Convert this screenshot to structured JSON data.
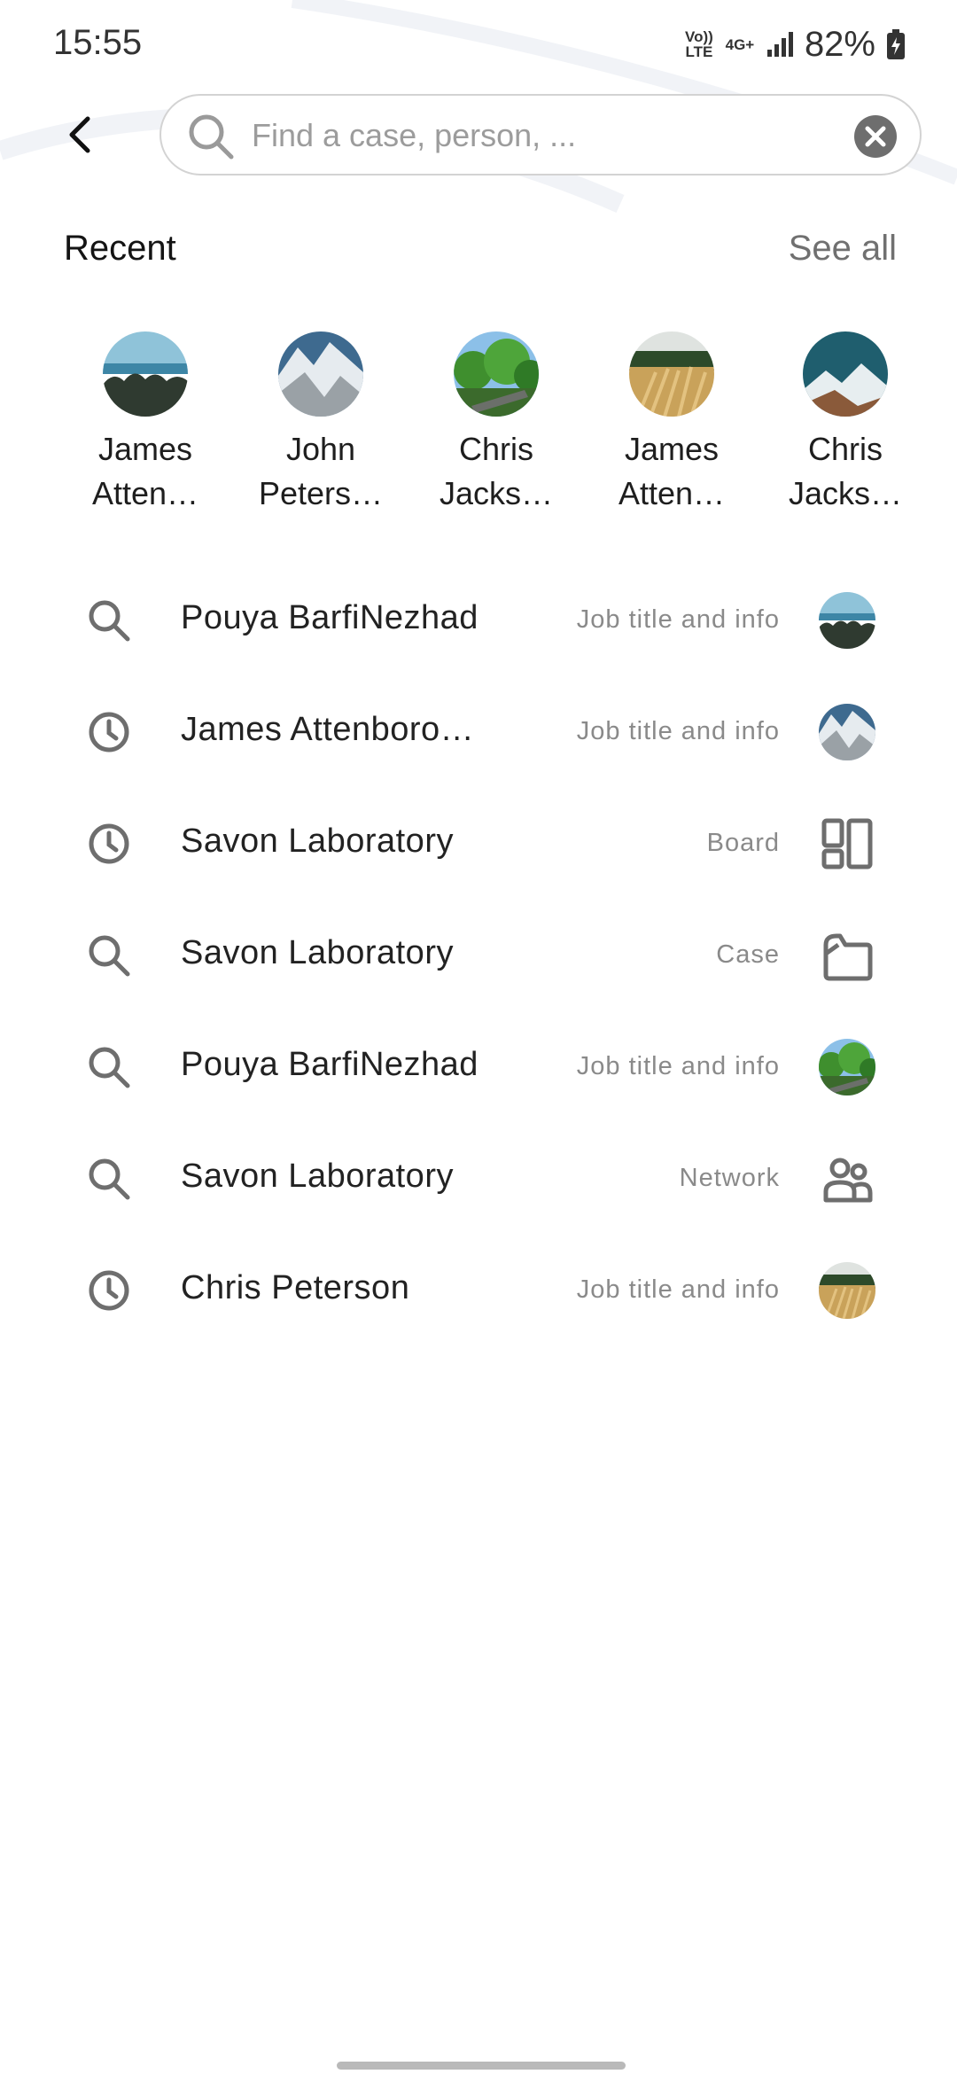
{
  "status_bar": {
    "time": "15:55",
    "volte": "Vo))\nLTE",
    "net": "4G+",
    "battery": "82%"
  },
  "search": {
    "placeholder": "Find a case, person, ...",
    "value": ""
  },
  "recent": {
    "title": "Recent",
    "see_all": "See all",
    "items": [
      {
        "line1": "James",
        "line2": "Atten…",
        "avatar": "sea-forest"
      },
      {
        "line1": "John",
        "line2": "Peters…",
        "avatar": "snowy-mountain"
      },
      {
        "line1": "Chris",
        "line2": "Jacks…",
        "avatar": "green-forest"
      },
      {
        "line1": "James",
        "line2": "Atten…",
        "avatar": "golden-grass"
      },
      {
        "line1": "Chris",
        "line2": "Jacks…",
        "avatar": "teal-mountain"
      }
    ]
  },
  "results": [
    {
      "lead_icon": "search-icon",
      "title": "Pouya BarfiNezhad",
      "subtitle": "Job title and info",
      "trail": "avatar",
      "avatar": "sea-forest"
    },
    {
      "lead_icon": "clock-icon",
      "title": "James Attenboro…",
      "subtitle": "Job title and info",
      "trail": "avatar",
      "avatar": "snowy-mountain"
    },
    {
      "lead_icon": "clock-icon",
      "title": "Savon Laboratory",
      "subtitle": "Board",
      "trail": "board-icon"
    },
    {
      "lead_icon": "search-icon",
      "title": "Savon Laboratory",
      "subtitle": "Case",
      "trail": "folder-icon"
    },
    {
      "lead_icon": "search-icon",
      "title": "Pouya BarfiNezhad",
      "subtitle": "Job title and info",
      "trail": "avatar",
      "avatar": "green-forest"
    },
    {
      "lead_icon": "search-icon",
      "title": "Savon Laboratory",
      "subtitle": "Network",
      "trail": "people-icon"
    },
    {
      "lead_icon": "clock-icon",
      "title": "Chris Peterson",
      "subtitle": "Job title and info",
      "trail": "avatar",
      "avatar": "golden-grass"
    }
  ]
}
